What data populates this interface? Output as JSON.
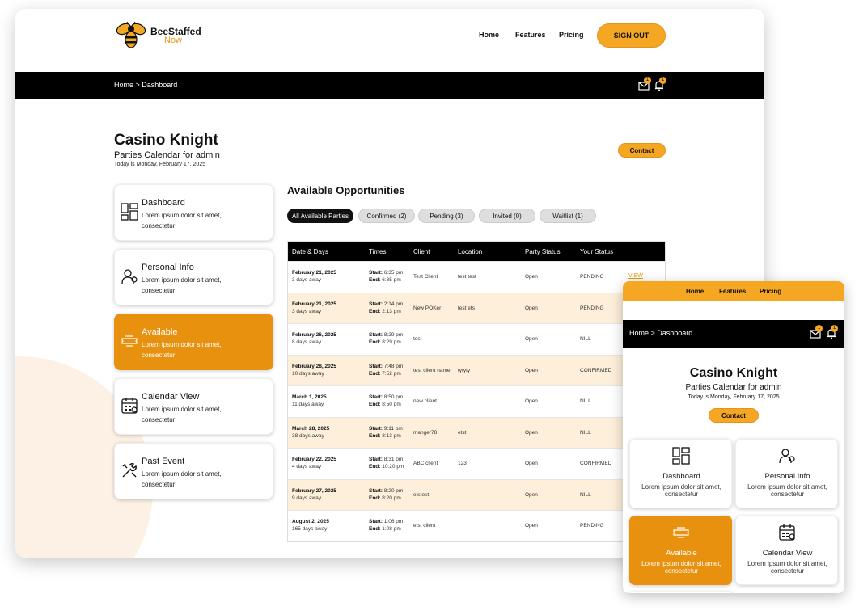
{
  "brand": {
    "name_line1": "BeeStaffed",
    "name_line2": "Now"
  },
  "nav": {
    "home": "Home",
    "features": "Features",
    "pricing": "Pricing",
    "signout": "SIGN OUT"
  },
  "breadcrumb": "Home > Dashboard",
  "notifications": {
    "messages_count": "1",
    "alerts_count": "1"
  },
  "page": {
    "title": "Casino Knight",
    "subtitle": "Parties Calendar for admin",
    "today": "Today is Monday, February 17, 2025",
    "contact": "Contact"
  },
  "sidebar": {
    "items": [
      {
        "icon": "dashboard-icon",
        "title": "Dashboard",
        "desc": "Lorem ipsum dolor sit amet, consectetur"
      },
      {
        "icon": "personal-info-icon",
        "title": "Personal Info",
        "desc": "Lorem ipsum dolor sit amet, consectetur"
      },
      {
        "icon": "available-ticket-icon",
        "title": "Available",
        "desc": "Lorem ipsum dolor sit amet, consectetur"
      },
      {
        "icon": "calendar-icon",
        "title": "Calendar View",
        "desc": "Lorem ipsum dolor sit amet, consectetur"
      },
      {
        "icon": "tools-icon",
        "title": "Past Event",
        "desc": "Lorem ipsum dolor sit amet, consectetur"
      }
    ]
  },
  "opportunities": {
    "title": "Available Opportunities",
    "filters": [
      "All Available Parties",
      "Confirmed (2)",
      "Pending (3)",
      "Invited (0)",
      "Waitlist (1)"
    ],
    "columns": [
      "Date & Days",
      "Times",
      "Client",
      "Location",
      "Party Status",
      "Your Status"
    ],
    "start_label": "Start:",
    "end_label": "End:",
    "view_label": "VIEW",
    "rows": [
      {
        "date": "February 21, 2025",
        "days": "3 days away",
        "start": "6:35 pm",
        "end": "6:35 pm",
        "client": "Test Client",
        "location": "test test",
        "party_status": "Open",
        "your_status": "PENDING"
      },
      {
        "date": "February 21, 2025",
        "days": "3 days away",
        "start": "2:14 pm",
        "end": "2:13 pm",
        "client": "New POKer",
        "location": "test ets",
        "party_status": "Open",
        "your_status": "PENDING"
      },
      {
        "date": "February 26, 2025",
        "days": "8 days away",
        "start": "8:29 pm",
        "end": "8:29 pm",
        "client": "test",
        "location": "",
        "party_status": "Open",
        "your_status": "NILL"
      },
      {
        "date": "February 28, 2025",
        "days": "10 days away",
        "start": "7:48 pm",
        "end": "7:52 pm",
        "client": "test client name",
        "location": "tytyty",
        "party_status": "Open",
        "your_status": "CONFIRMED"
      },
      {
        "date": "March 1, 2025",
        "days": "11 days away",
        "start": "8:50 pm",
        "end": "8:50 pm",
        "client": "new client",
        "location": "",
        "party_status": "Open",
        "your_status": "NILL"
      },
      {
        "date": "March 28, 2025",
        "days": "38 days away",
        "start": "9:11 pm",
        "end": "8:13 pm",
        "client": "manger78",
        "location": "etst",
        "party_status": "Open",
        "your_status": "NILL"
      },
      {
        "date": "February 22, 2025",
        "days": "4 days away",
        "start": "8:31 pm",
        "end": "10:20 pm",
        "client": "ABC client",
        "location": "123",
        "party_status": "Open",
        "your_status": "CONFIRMED"
      },
      {
        "date": "February 27, 2025",
        "days": "9 days away",
        "start": "8:20 pm",
        "end": "8:20 pm",
        "client": "etstest",
        "location": "",
        "party_status": "Open",
        "your_status": "NILL"
      },
      {
        "date": "August 2, 2025",
        "days": "165 days away",
        "start": "1:06 pm",
        "end": "1:08 pm",
        "client": "etst client",
        "location": "",
        "party_status": "Open",
        "your_status": "PENDING"
      }
    ]
  },
  "mobile": {
    "cards": [
      {
        "icon": "dashboard-icon",
        "title": "Dashboard",
        "desc": "Lorem ipsum dolor sit amet, consectetur"
      },
      {
        "icon": "personal-info-icon",
        "title": "Personal Info",
        "desc": "Lorem ipsum dolor sit amet, consectetur"
      },
      {
        "icon": "available-ticket-icon",
        "title": "Available",
        "desc": "Lorem ipsum dolor sit amet, consectetur"
      },
      {
        "icon": "calendar-icon",
        "title": "Calendar View",
        "desc": "Lorem ipsum dolor sit amet, consectetur"
      }
    ]
  },
  "colors": {
    "accent": "#f5a623",
    "active_card": "#e8910e",
    "row_alt": "#fdefd9",
    "bar": "#000000"
  }
}
